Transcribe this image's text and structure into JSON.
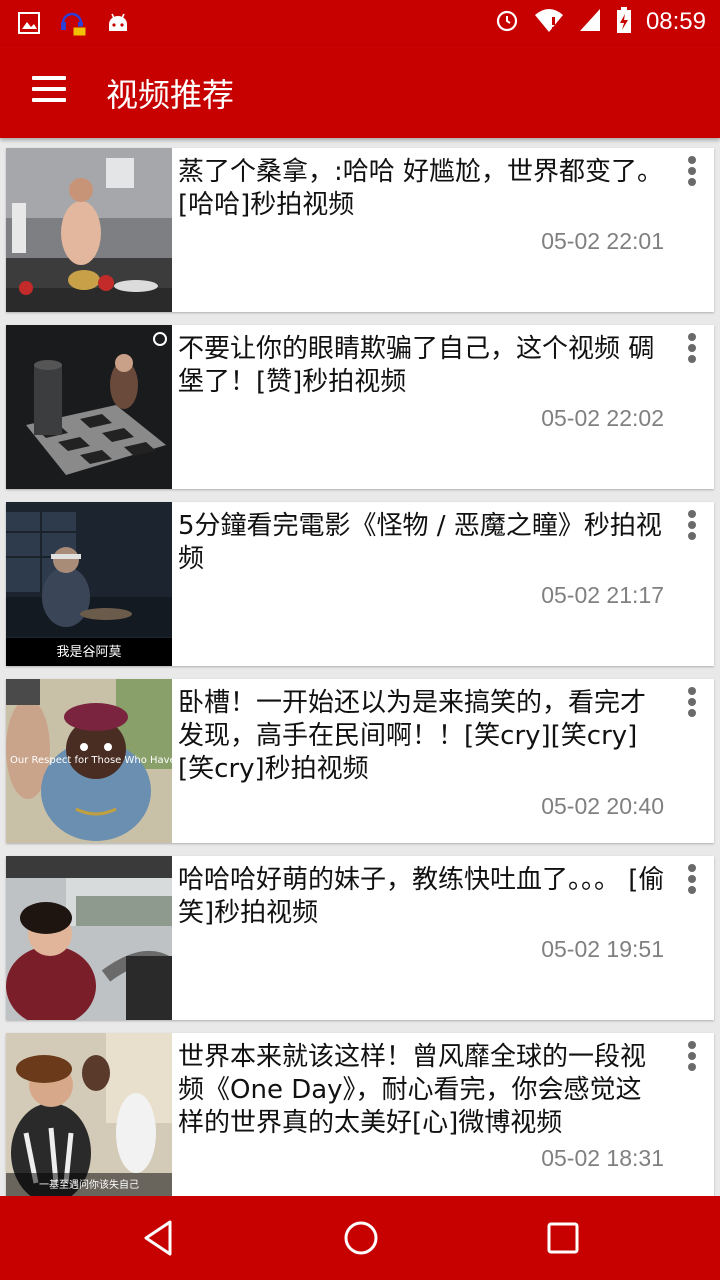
{
  "status_bar": {
    "time": "08:59",
    "icons": [
      "image-icon",
      "headset-chat-icon",
      "android-icon",
      "alarm-icon",
      "wifi-alert-icon",
      "signal-icon",
      "battery-charging-icon"
    ]
  },
  "app_bar": {
    "title": "视频推荐",
    "menu_icon": "hamburger-menu-icon"
  },
  "feed": {
    "items": [
      {
        "title": "蒸了个桑拿，:哈哈  好尴尬，世界都变了。[哈哈]秒拍视频",
        "time": "05-02 22:01"
      },
      {
        "title": "不要让你的眼睛欺骗了自己，这个视频 碉堡了！[赞]秒拍视频",
        "time": "05-02 22:02"
      },
      {
        "title": "5分鐘看完電影《怪物 / 恶魔之瞳》秒拍视频",
        "time": "05-02 21:17",
        "thumb_caption": "我是谷阿莫"
      },
      {
        "title": "卧槽！一开始还以为是来搞笑的，看完才发现，高手在民间啊！！[笑cry][笑cry][笑cry]秒拍视频",
        "time": "05-02 20:40",
        "thumb_caption": "Our Respect for Those Who Have"
      },
      {
        "title": "哈哈哈好萌的妹子，教练快吐血了。。。 [偷笑]秒拍视频",
        "time": "05-02 19:51"
      },
      {
        "title": "世界本来就该这样！曾风靡全球的一段视频《One Day》，耐心看完，你会感觉这样的世界真的太美好[心]微博视频",
        "time": "05-02 18:31",
        "thumb_caption": "一基至遇问你该失自己"
      }
    ]
  },
  "nav_bar": {
    "icons": [
      "back-icon",
      "home-icon",
      "recents-icon"
    ]
  },
  "colors": {
    "primary": "#c70000",
    "card_bg": "#ffffff",
    "page_bg": "#e9e9e9",
    "time_text": "#808080"
  }
}
